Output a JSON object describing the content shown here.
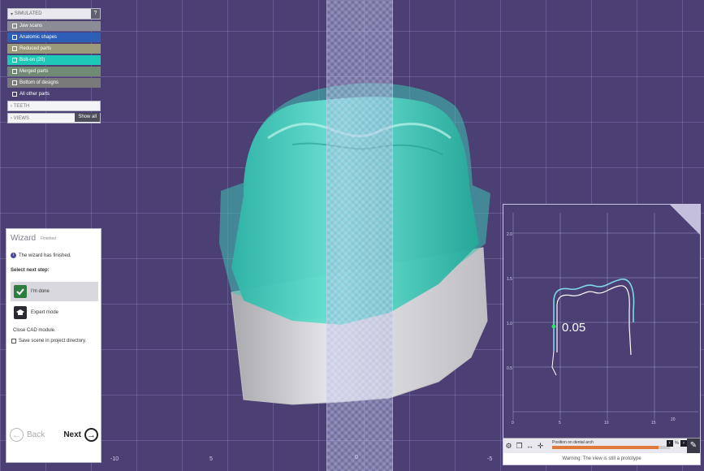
{
  "scene_tree": {
    "help_label": "?",
    "group_label": "SIMULATED",
    "items": [
      {
        "label": "Jaw scans",
        "color": "#8c8c96"
      },
      {
        "label": "Anatomic shapes",
        "color": "#2c5fb5"
      },
      {
        "label": "Reduced parts",
        "color": "#9a9a7a"
      },
      {
        "label": "Bolt-on (20)",
        "color": "#1fc9b7"
      },
      {
        "label": "Merged parts",
        "color": "#708a73"
      },
      {
        "label": "Bottom of designs",
        "color": "#7a7a7a"
      },
      {
        "label": "All other parts",
        "color": "#4b3f74"
      }
    ],
    "section_teeth": "TEETH",
    "section_views": "VIEWS",
    "show_all": "Show all"
  },
  "wizard": {
    "title": "Wizard",
    "subtitle": "Finished",
    "info_text": "The wizard has finished.",
    "select_label": "Select next step:",
    "option_done": "I'm done",
    "option_expert": "Expert mode",
    "close_label": "Close CAD module.",
    "save_label": "Save scene in project directory.",
    "back_label": "Back",
    "next_label": "Next"
  },
  "profile_plot": {
    "measurement": "0.05",
    "y_ticks": [
      "2.0",
      "1.5",
      "1.0",
      "0.5"
    ],
    "x_ticks": [
      "0",
      "5",
      "10",
      "15",
      "20"
    ],
    "position_label": "Position on dental arch",
    "position_value": 0.9,
    "zoom_label": "%",
    "warning": "Warning: The view is still a prototype"
  },
  "viewport": {
    "bottom_labels": [
      "5",
      "0",
      "-5"
    ],
    "left_labels": [
      "-10"
    ]
  }
}
